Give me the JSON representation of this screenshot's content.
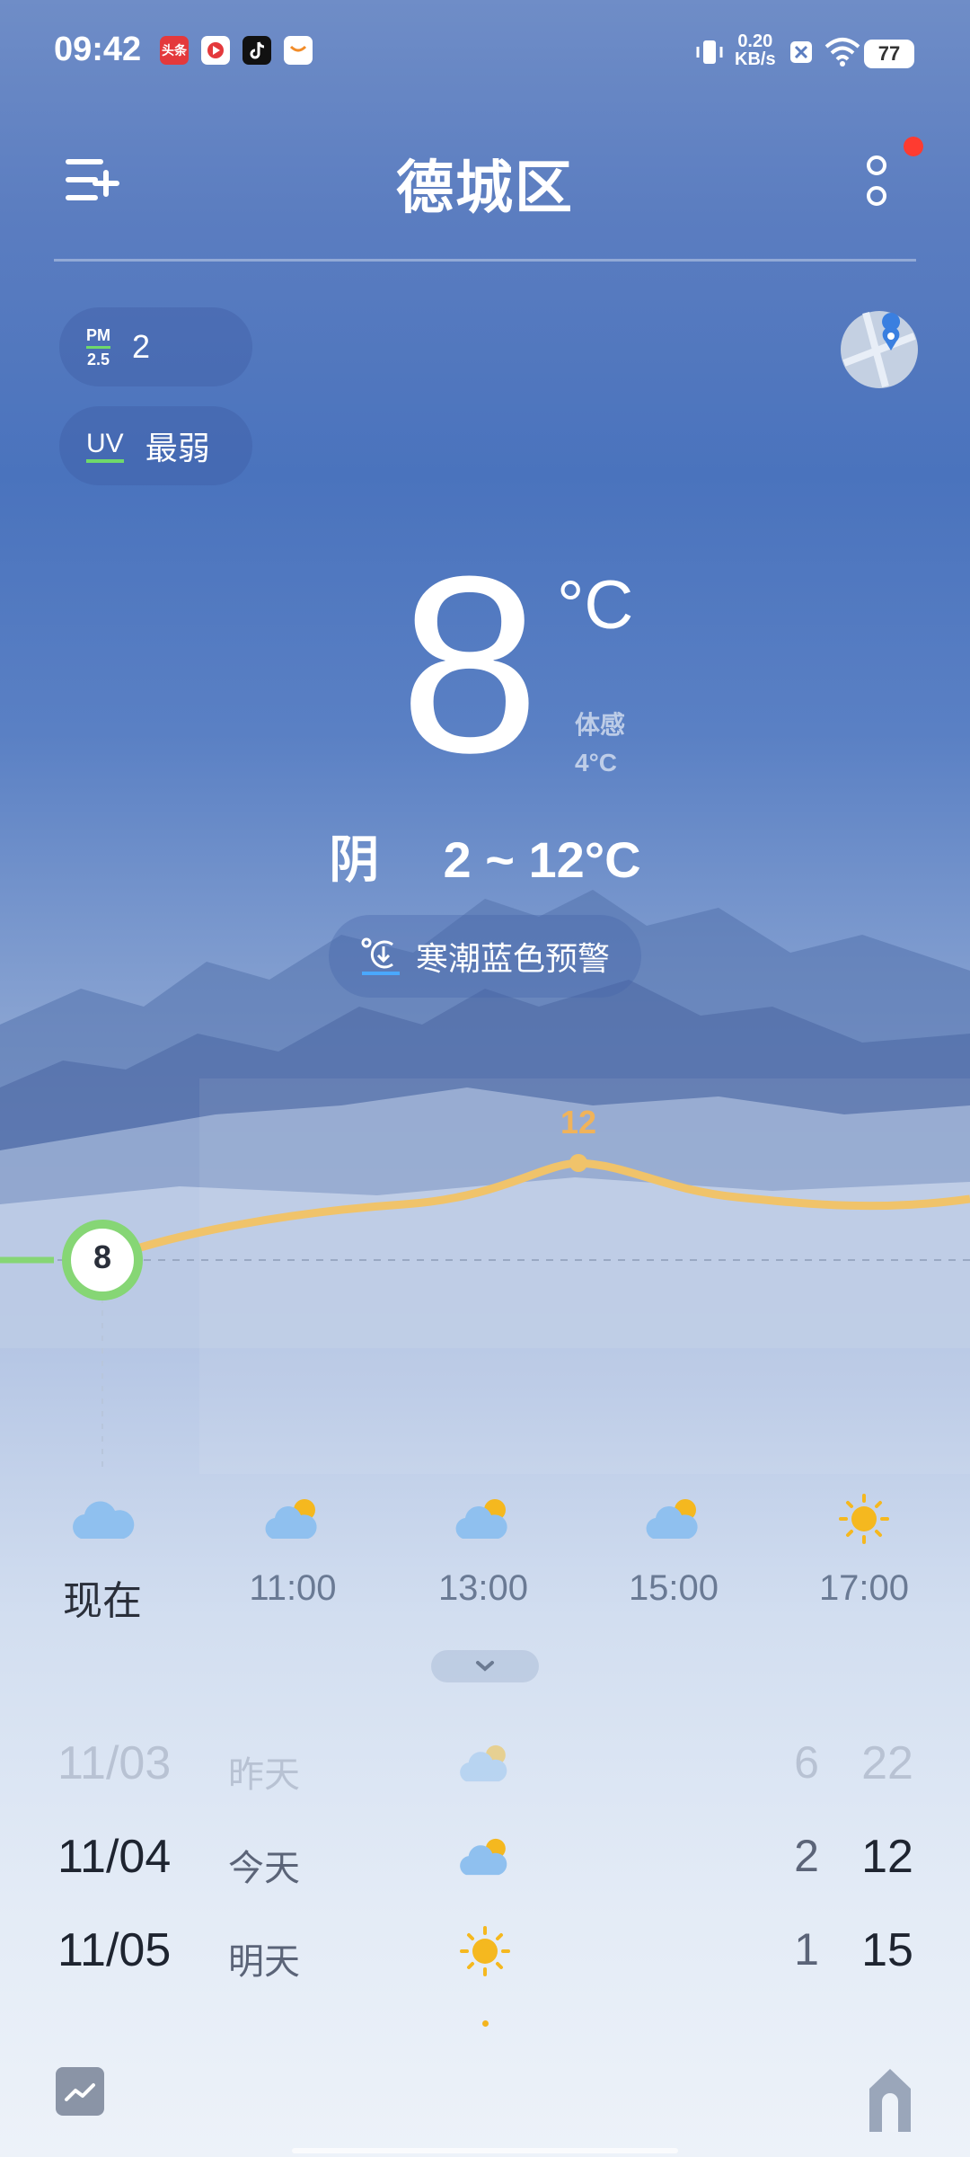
{
  "status": {
    "time": "09:42",
    "net_speed_value": "0.20",
    "net_speed_unit": "KB/s",
    "battery": "77",
    "app_icon_1": "头条"
  },
  "header": {
    "city": "德城区",
    "menu_icon": "menu-add-icon",
    "more_icon": "more-icon"
  },
  "air": {
    "pm_label_top": "PM",
    "pm_label_bottom": "2.5",
    "pm_value": "2",
    "uv_label": "UV",
    "uv_value": "最弱"
  },
  "current": {
    "temp": "8",
    "unit": "°C",
    "feels_label": "体感",
    "feels_value": "4°C",
    "condition": "阴",
    "range": "2 ~ 12°C"
  },
  "alert": {
    "text": "寒潮蓝色预警"
  },
  "curve": {
    "now_value": "8",
    "peak_value": "12"
  },
  "hourly": [
    {
      "label": "现在",
      "icon": "cloudy"
    },
    {
      "label": "11:00",
      "icon": "partly-cloudy"
    },
    {
      "label": "13:00",
      "icon": "partly-cloudy"
    },
    {
      "label": "15:00",
      "icon": "partly-cloudy"
    },
    {
      "label": "17:00",
      "icon": "sunny"
    }
  ],
  "daily": [
    {
      "date": "11/03",
      "day": "昨天",
      "icon": "partly-cloudy",
      "low": "6",
      "high": "22"
    },
    {
      "date": "11/04",
      "day": "今天",
      "icon": "partly-cloudy",
      "low": "2",
      "high": "12"
    },
    {
      "date": "11/05",
      "day": "明天",
      "icon": "sunny",
      "low": "1",
      "high": "15"
    }
  ],
  "colors": {
    "curve": "#f0c36a",
    "now_ring": "#86d675",
    "sun": "#f5b81f",
    "cloud": "#8fc0ef"
  }
}
